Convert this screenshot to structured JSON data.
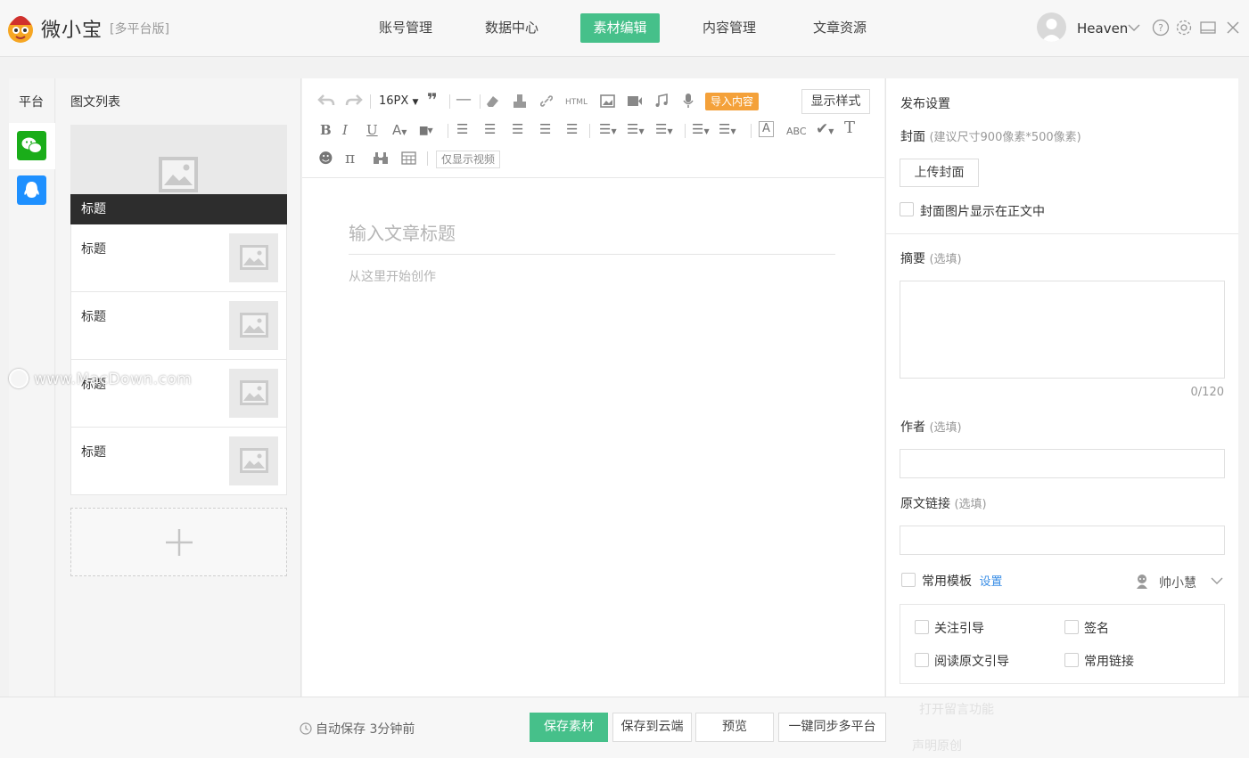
{
  "app": {
    "name": "微小宝",
    "edition": "[多平台版]"
  },
  "nav": [
    {
      "label": "账号管理",
      "active": false
    },
    {
      "label": "数据中心",
      "active": false
    },
    {
      "label": "素材编辑",
      "active": true
    },
    {
      "label": "内容管理",
      "active": false
    },
    {
      "label": "文章资源",
      "active": false
    }
  ],
  "user": {
    "name": "Heaven"
  },
  "platform": {
    "title": "平台",
    "items": [
      {
        "name": "wechat-icon",
        "color": "#1aad19",
        "active": true
      },
      {
        "name": "qq-icon",
        "color": "#1e90ff",
        "active": false
      }
    ]
  },
  "article_list": {
    "title": "图文列表",
    "cover_label": "标题",
    "items": [
      "标题",
      "标题",
      "标题",
      "标题"
    ]
  },
  "watermark": "www.MacDown.com",
  "editor": {
    "font_size": "16PX",
    "import_label": "导入内容",
    "style_label": "显示样式",
    "html_label": "HTML",
    "abc_label": "ABC",
    "video_only_label": "仅显示视频",
    "title_placeholder": "输入文章标题",
    "body_placeholder": "从这里开始创作"
  },
  "publish": {
    "title": "发布设置",
    "cover_label": "封面",
    "cover_hint": "(建议尺寸900像素*500像素)",
    "upload_label": "上传封面",
    "show_cover_label": "封面图片显示在正文中",
    "summary_label": "摘要",
    "optional_hint": "(选填)",
    "summary_counter": "0/120",
    "author_label": "作者",
    "source_label": "原文链接",
    "template_label": "常用模板",
    "template_link": "设置",
    "assistant_name": "帅小慧",
    "template_options": [
      "关注引导",
      "签名",
      "阅读原文引导",
      "常用链接"
    ],
    "faded_comment": "打开留言功能",
    "faded_declare": "声明原创"
  },
  "bottom": {
    "autosave": "自动保存 3分钟前",
    "save_label": "保存素材",
    "cloud_label": "保存到云端",
    "preview_label": "预览",
    "sync_label": "一键同步多平台"
  }
}
